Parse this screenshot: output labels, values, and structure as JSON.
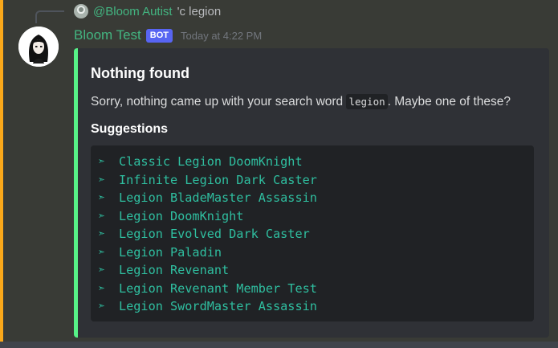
{
  "reply": {
    "user": "@Bloom Autist",
    "text": "'c legion"
  },
  "message": {
    "author": "Bloom Test",
    "bot_tag": "BOT",
    "timestamp": "Today at 4:22 PM"
  },
  "embed": {
    "title": "Nothing found",
    "description_before": "Sorry, nothing came up with your search word ",
    "search_word": "legion",
    "description_after": ". Maybe one of these?",
    "field_name": "Suggestions",
    "arrow": "➣",
    "suggestions": [
      "Classic Legion DoomKnight",
      "Infinite Legion Dark Caster",
      "Legion BladeMaster Assassin",
      "Legion DoomKnight",
      "Legion Evolved Dark Caster",
      "Legion Paladin",
      "Legion Revenant",
      "Legion Revenant Member Test",
      "Legion SwordMaster Assassin"
    ]
  },
  "colors": {
    "mention_bar": "#faa81a",
    "author": "#43b581",
    "bot_tag": "#5865f2",
    "embed_stripe": "#57f287",
    "code_text": "#2fbfa0"
  }
}
